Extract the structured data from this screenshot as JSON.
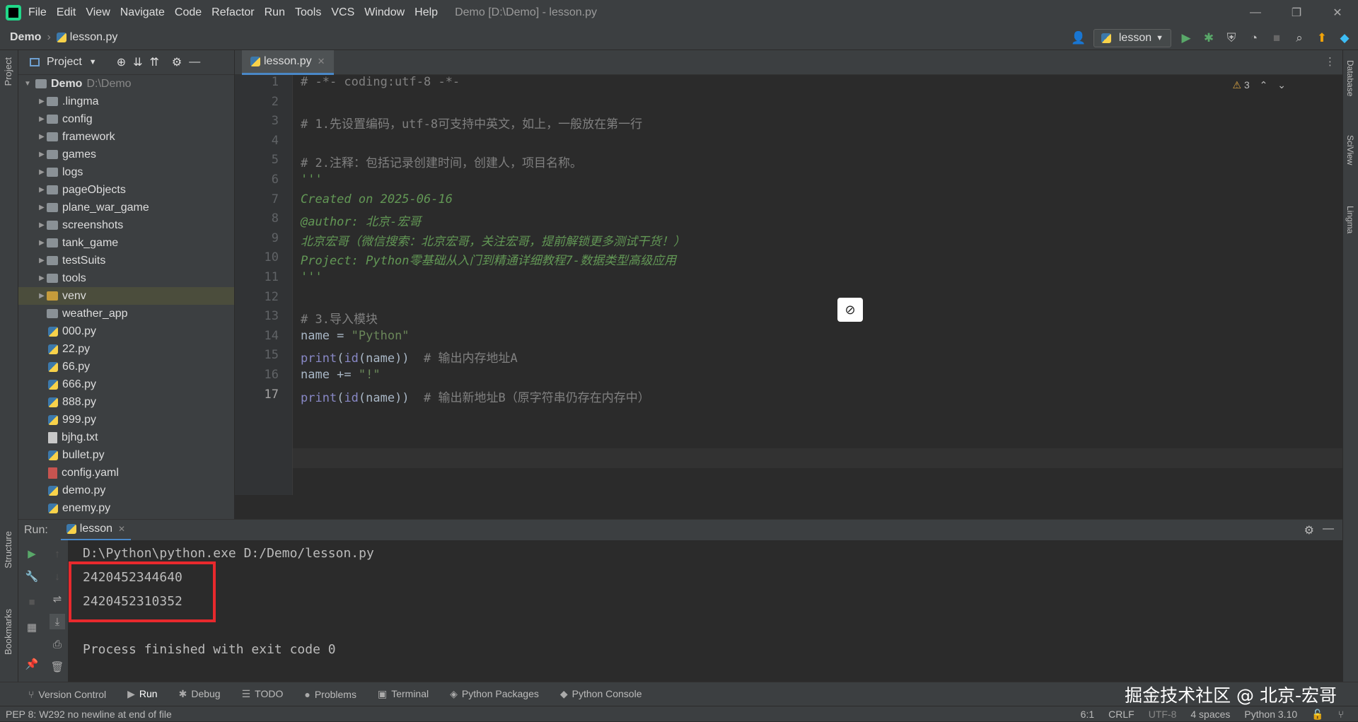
{
  "menu": [
    "File",
    "Edit",
    "View",
    "Navigate",
    "Code",
    "Refactor",
    "Run",
    "Tools",
    "VCS",
    "Window",
    "Help"
  ],
  "window_title": "Demo [D:\\Demo] - lesson.py",
  "breadcrumb": {
    "project": "Demo",
    "file": "lesson.py"
  },
  "run_config": "lesson",
  "project_panel": {
    "title": "Project"
  },
  "tree": {
    "root": {
      "name": "Demo",
      "path": "D:\\Demo"
    },
    "folders": [
      ".lingma",
      "config",
      "framework",
      "games",
      "logs",
      "pageObjects",
      "plane_war_game",
      "screenshots",
      "tank_game",
      "testSuits",
      "tools",
      "venv",
      "weather_app"
    ],
    "files": [
      "000.py",
      "22.py",
      "66.py",
      "666.py",
      "888.py",
      "999.py",
      "bjhg.txt",
      "bullet.py",
      "config.yaml",
      "demo.py",
      "enemy.py"
    ]
  },
  "editor": {
    "tab": "lesson.py",
    "warning_count": "3",
    "lines": [
      "# -*- coding:utf-8 -*-",
      "",
      "# 1.先设置编码，utf-8可支持中英文，如上，一般放在第一行",
      "",
      "# 2.注释：包括记录创建时间，创建人，项目名称。",
      "'''",
      "Created on 2025-06-16",
      "@author: 北京-宏哥",
      "北京宏哥（微信搜索：北京宏哥，关注宏哥，提前解锁更多测试干货！）",
      "Project: Python零基础从入门到精通详细教程7-数据类型高级应用",
      "'''",
      "",
      "# 3.导入模块",
      "name = \"Python\"",
      "print(id(name))  # 输出内存地址A",
      "name += \"!\"",
      "print(id(name))  # 输出新地址B（原字符串仍存在内存中）"
    ],
    "line_numbers": [
      "1",
      "2",
      "3",
      "4",
      "5",
      "6",
      "7",
      "8",
      "9",
      "10",
      "11",
      "12",
      "13",
      "14",
      "15",
      "16",
      "17"
    ],
    "current_line": "17"
  },
  "run": {
    "label": "Run:",
    "tab": "lesson",
    "output": [
      "D:\\Python\\python.exe D:/Demo/lesson.py",
      "2420452344640",
      "2420452310352",
      "",
      "Process finished with exit code 0"
    ]
  },
  "bottom_tools": [
    "Version Control",
    "Run",
    "Debug",
    "TODO",
    "Problems",
    "Terminal",
    "Python Packages",
    "Python Console"
  ],
  "status": {
    "message": "PEP 8: W292 no newline at end of file",
    "position": "6:1",
    "line_sep": "CRLF",
    "encoding": "UTF-8",
    "indent": "4 spaces",
    "interpreter": "Python 3.10"
  },
  "side_tabs": {
    "left": [
      "Project",
      "Structure",
      "Bookmarks"
    ],
    "right": [
      "Database",
      "SciView",
      "Lingma"
    ]
  },
  "watermark": "掘金技术社区 @ 北京-宏哥"
}
